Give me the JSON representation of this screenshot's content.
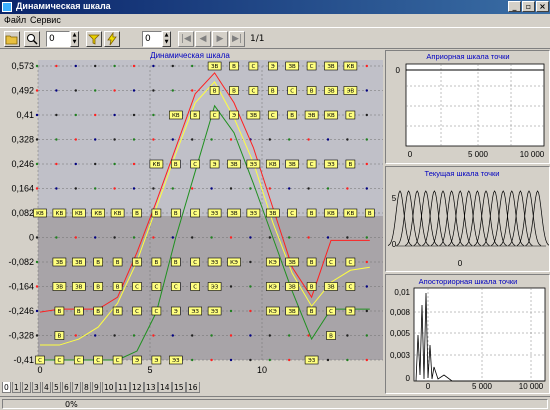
{
  "window": {
    "title": "Динамическая шкала",
    "buttons": {
      "minimize": "_",
      "maximize": "▫",
      "close": "×"
    }
  },
  "menu": {
    "items": [
      "Файл",
      "Сервис"
    ]
  },
  "toolbar": {
    "spin1_value": "0",
    "spin2_value": "0",
    "page_indicator": "1/1",
    "nav": [
      "|◀",
      "◀",
      "▶",
      "▶|"
    ]
  },
  "main_chart": {
    "title": "Динамическая шкала",
    "y_ticks": [
      "0,573",
      "0,492",
      "0,41",
      "0,328",
      "0,246",
      "0,164",
      "0,082",
      "0",
      "-0,082",
      "-0,164",
      "-0,246",
      "-0,328",
      "-0,41"
    ],
    "x_ticks": [
      "0",
      "5",
      "10"
    ],
    "colors": {
      "upper_bg": "#c0c0c8",
      "lower_bg": "#a8a4a8",
      "red": "#ff2020",
      "yellow": "#ffff40",
      "green": "#209020"
    },
    "badge_rows": [
      [
        "",
        "",
        "",
        "",
        "",
        "",
        "",
        "",
        "",
        "ЗВ",
        "В",
        "С",
        "Э",
        "ЗВ",
        "С",
        "ЗВ",
        "КВ",
        ""
      ],
      [
        "",
        "",
        "",
        "",
        "",
        "",
        "",
        "",
        "",
        "В",
        "В",
        "С",
        "В",
        "С",
        "В",
        "ЗВ",
        "ЭВ",
        ""
      ],
      [
        "",
        "",
        "",
        "",
        "",
        "",
        "",
        "КВ",
        "В",
        "С",
        "Э",
        "ЗВ",
        "С",
        "В",
        "ЭВ",
        "КВ",
        "С",
        ""
      ],
      [
        "",
        "",
        "",
        "",
        "",
        "",
        "",
        "",
        "",
        "",
        "",
        "",
        "",
        "",
        "",
        "",
        "",
        ""
      ],
      [
        "",
        "",
        "",
        "",
        "",
        "",
        "КВ",
        "В",
        "С",
        "Э",
        "ЗВ",
        "ЭЗ",
        "КВ",
        "ЗВ",
        "С",
        "ЭЗ",
        "В",
        ""
      ],
      [
        "",
        "",
        "",
        "",
        "",
        "",
        "",
        "",
        "",
        "",
        "",
        "",
        "",
        "",
        "",
        "",
        "",
        ""
      ],
      [
        "КВ",
        "КВ",
        "КВ",
        "КВ",
        "КВ",
        "В",
        "В",
        "В",
        "С",
        "ЭЗ",
        "ЗВ",
        "ЭЗ",
        "ЗВ",
        "С",
        "В",
        "КВ",
        "КВ",
        "В"
      ],
      [
        "",
        "",
        "",
        "",
        "",
        "",
        "",
        "",
        "",
        "",
        "",
        "",
        "",
        "",
        "",
        "",
        "",
        ""
      ],
      [
        "",
        "ЗВ",
        "ЗВ",
        "В",
        "В",
        "В",
        "В",
        "В",
        "С",
        "ЭЗ",
        "КЭ",
        "",
        "КЭ",
        "ЗВ",
        "В",
        "С",
        "С",
        ""
      ],
      [
        "",
        "ЗВ",
        "ЗВ",
        "В",
        "В",
        "С",
        "С",
        "С",
        "С",
        "ЭЗ",
        "",
        "",
        "КЭ",
        "ЗВ",
        "В",
        "ЗВ",
        "С",
        ""
      ],
      [
        "",
        "В",
        "В",
        "В",
        "В",
        "С",
        "С",
        "Э",
        "ЭЗ",
        "ЭЗ",
        "",
        "",
        "КЭ",
        "ЗВ",
        "В",
        "С",
        "Э",
        ""
      ],
      [
        "",
        "В",
        "",
        "",
        "",
        "",
        "",
        "",
        "",
        "",
        "",
        "",
        "",
        "",
        "",
        "В",
        "",
        ""
      ],
      [
        "С",
        "С",
        "С",
        "С",
        "С",
        "Э",
        "Э",
        "ЭЗ",
        "",
        "",
        "",
        "",
        "",
        "",
        "ЭЗ",
        "",
        "",
        ""
      ]
    ],
    "series_red": [
      -0.25,
      -0.24,
      -0.24,
      -0.24,
      -0.2,
      -0.05,
      0.12,
      0.3,
      0.48,
      0.55,
      0.45,
      0.3,
      0.1,
      -0.1,
      -0.2,
      -0.01,
      -0.01,
      -0.01
    ],
    "series_yellow": [
      -0.36,
      -0.36,
      -0.34,
      -0.3,
      -0.22,
      -0.08,
      0.1,
      0.28,
      0.45,
      0.52,
      0.4,
      0.25,
      0.05,
      -0.12,
      -0.23,
      -0.15,
      -0.11,
      -0.1
    ],
    "series_green": [
      -0.41,
      -0.41,
      -0.41,
      -0.41,
      -0.41,
      -0.38,
      -0.25,
      0.0,
      0.22,
      0.44,
      0.35,
      0.18,
      0.0,
      -0.18,
      -0.34,
      -0.24,
      -0.24,
      -0.24
    ]
  },
  "tabs": [
    "0",
    "1",
    "2",
    "3",
    "4",
    "5",
    "6",
    "7",
    "8",
    "9",
    "10",
    "11",
    "12",
    "13",
    "14",
    "15",
    "16"
  ],
  "status": {
    "progress_text": "0%"
  },
  "panels": {
    "apriori": {
      "title": "Априорная шкала точки",
      "x_ticks": [
        "0",
        "5 000",
        "10 000"
      ],
      "y_ticks": [
        "0"
      ]
    },
    "current": {
      "title": "Текущая шкала точки",
      "y_ticks": [
        "5",
        "0"
      ],
      "x_label": "0"
    },
    "aposteriori": {
      "title": "Апосториорная шкала точки",
      "y_ticks": [
        "0,01",
        "0,008",
        "0,005",
        "0,003",
        "0"
      ],
      "x_ticks": [
        "0",
        "5 000",
        "10 000"
      ]
    }
  }
}
